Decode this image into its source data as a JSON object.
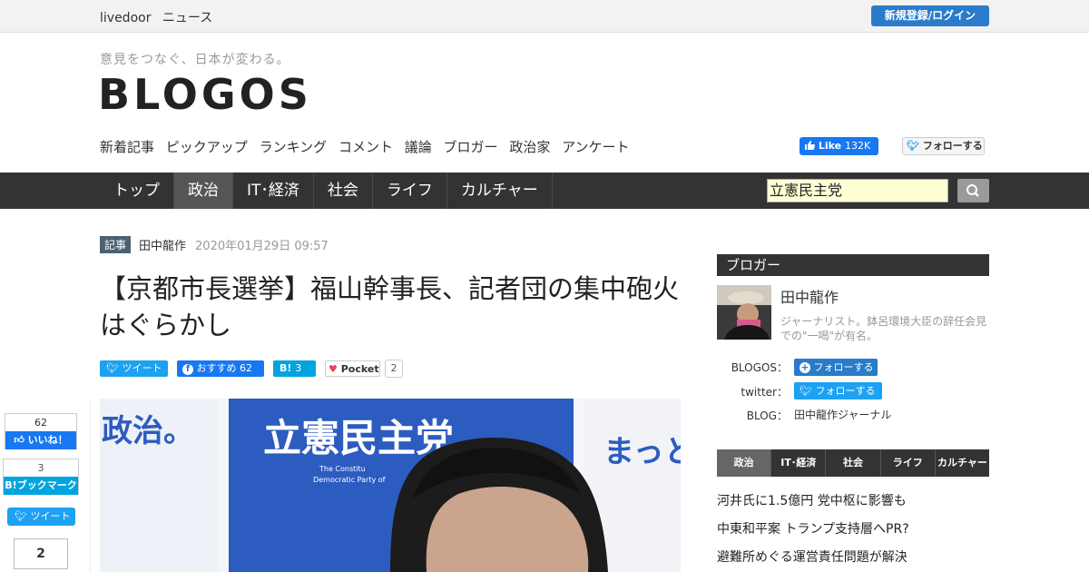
{
  "topbar": {
    "brand": "livedoor",
    "section": "ニュース",
    "login_label": "新規登録/ログイン"
  },
  "site": {
    "tagline": "意見をつなぐ、日本が変わる。",
    "logo": "BLOGOS"
  },
  "subnav": [
    "新着記事",
    "ピックアップ",
    "ランキング",
    "コメント",
    "議論",
    "ブロガー",
    "政治家",
    "アンケート"
  ],
  "social": {
    "fb_like_label": "Like",
    "fb_like_count": "132K",
    "tw_follow_label": "フォローする"
  },
  "mainnav": {
    "items": [
      "トップ",
      "政治",
      "IT･経済",
      "社会",
      "ライフ",
      "カルチャー"
    ],
    "active": "政治"
  },
  "search": {
    "value": "立憲民主党"
  },
  "article": {
    "tag": "記事",
    "author": "田中龍作",
    "date": "2020年01月29日 09:57",
    "title": "【京都市長選挙】福山幹事長、記者団の集中砲火はぐらかし",
    "share": {
      "tweet": "ツイート",
      "fb": "おすすめ 62",
      "hatena": "3",
      "pocket": "Pocket",
      "pocket_count": "2"
    }
  },
  "hero": {
    "left_text": "政治。",
    "banner_text": "立憲民主党",
    "banner_small1": "The Constitu",
    "banner_small2": "Democratic Party of",
    "right_text": "まっと"
  },
  "leftshare": {
    "fb_count": "62",
    "fb_label": "いいね！",
    "hb_count": "3",
    "hb_label": "ブックマーク",
    "tweet": "ツイート",
    "pocket_count": "2"
  },
  "sidebar": {
    "heading": "ブロガー",
    "blogger_name": "田中龍作",
    "blogger_desc": "ジャーナリスト。鉢呂環境大臣の辞任会見での\"一喝\"が有名。",
    "blogos_label": "BLOGOS：",
    "blogos_follow": "フォローする",
    "twitter_label": "twitter：",
    "twitter_follow": "フォローする",
    "blog_label": "BLOG：",
    "blog_link": "田中龍作ジャーナル",
    "cat_tabs": [
      "政治",
      "IT･経済",
      "社会",
      "ライフ",
      "カルチャー"
    ],
    "ranking": [
      "河井氏に1.5億円 党中枢に影響も",
      "中東和平案 トランプ支持層へPR?",
      "避難所めぐる運営責任問題が解決"
    ]
  },
  "colors": {
    "accent": "#2a7bc9",
    "nav_bg": "#333333",
    "twitter": "#1da1f2",
    "facebook": "#1877f2",
    "hatena": "#00a4de"
  }
}
